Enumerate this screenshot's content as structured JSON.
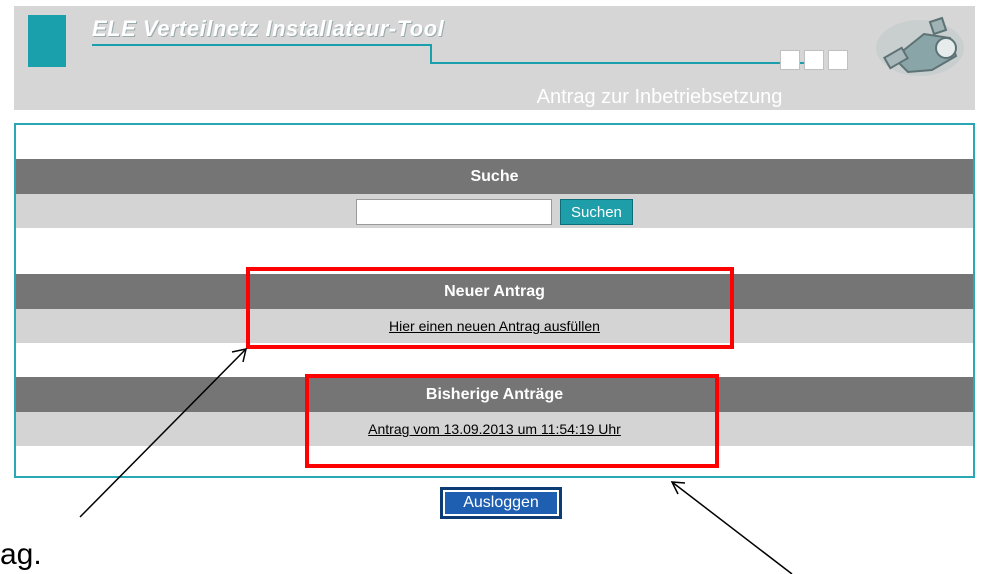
{
  "header": {
    "app_title": "ELE Verteilnetz Installateur-Tool",
    "page_subtitle": "Antrag zur Inbetriebsetzung"
  },
  "search": {
    "heading": "Suche",
    "input_value": "",
    "button_label": "Suchen"
  },
  "new_request": {
    "heading": "Neuer Antrag",
    "link_label": "Hier einen neuen Antrag ausfüllen"
  },
  "previous_requests": {
    "heading": "Bisherige Anträge",
    "items": [
      {
        "label": "Antrag vom 13.09.2013 um 11:54:19 Uhr"
      }
    ]
  },
  "logout": {
    "button_label": "Ausloggen"
  },
  "annotation": {
    "text": "ag."
  },
  "colors": {
    "accent_teal": "#1aa0ad",
    "header_gray": "#d6d6d6",
    "section_head": "#757575",
    "section_body": "#d4d4d4",
    "highlight_red": "#ff0000",
    "logout_blue": "#1e5fb2"
  }
}
